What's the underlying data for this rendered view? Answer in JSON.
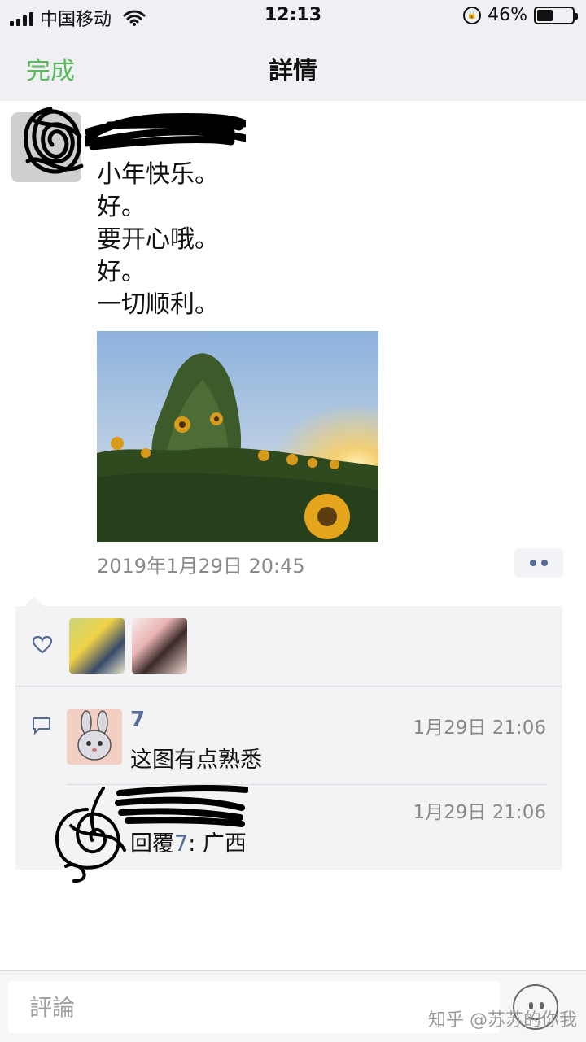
{
  "status_bar": {
    "carrier": "中国移动",
    "time": "12:13",
    "battery_percent_label": "46%",
    "battery_level": 0.46
  },
  "nav": {
    "done_label": "完成",
    "title": "詳情"
  },
  "post": {
    "lines": [
      "小年快乐。",
      "好。",
      "要开心哦。",
      "好。",
      "一切顺利。"
    ],
    "timestamp": "2019年1月29日 20:45"
  },
  "comments": [
    {
      "author": "7",
      "time": "1月29日 21:06",
      "text": "这图有点熟悉"
    },
    {
      "time": "1月29日 21:06",
      "reply_prefix": "回覆",
      "reply_to": "7",
      "reply_sep": ": ",
      "text": "广西"
    }
  ],
  "input": {
    "placeholder": "評論"
  },
  "watermark": "知乎 @苏苏的你我",
  "colors": {
    "accent_green": "#5ab95c",
    "link_blue": "#576b95"
  }
}
